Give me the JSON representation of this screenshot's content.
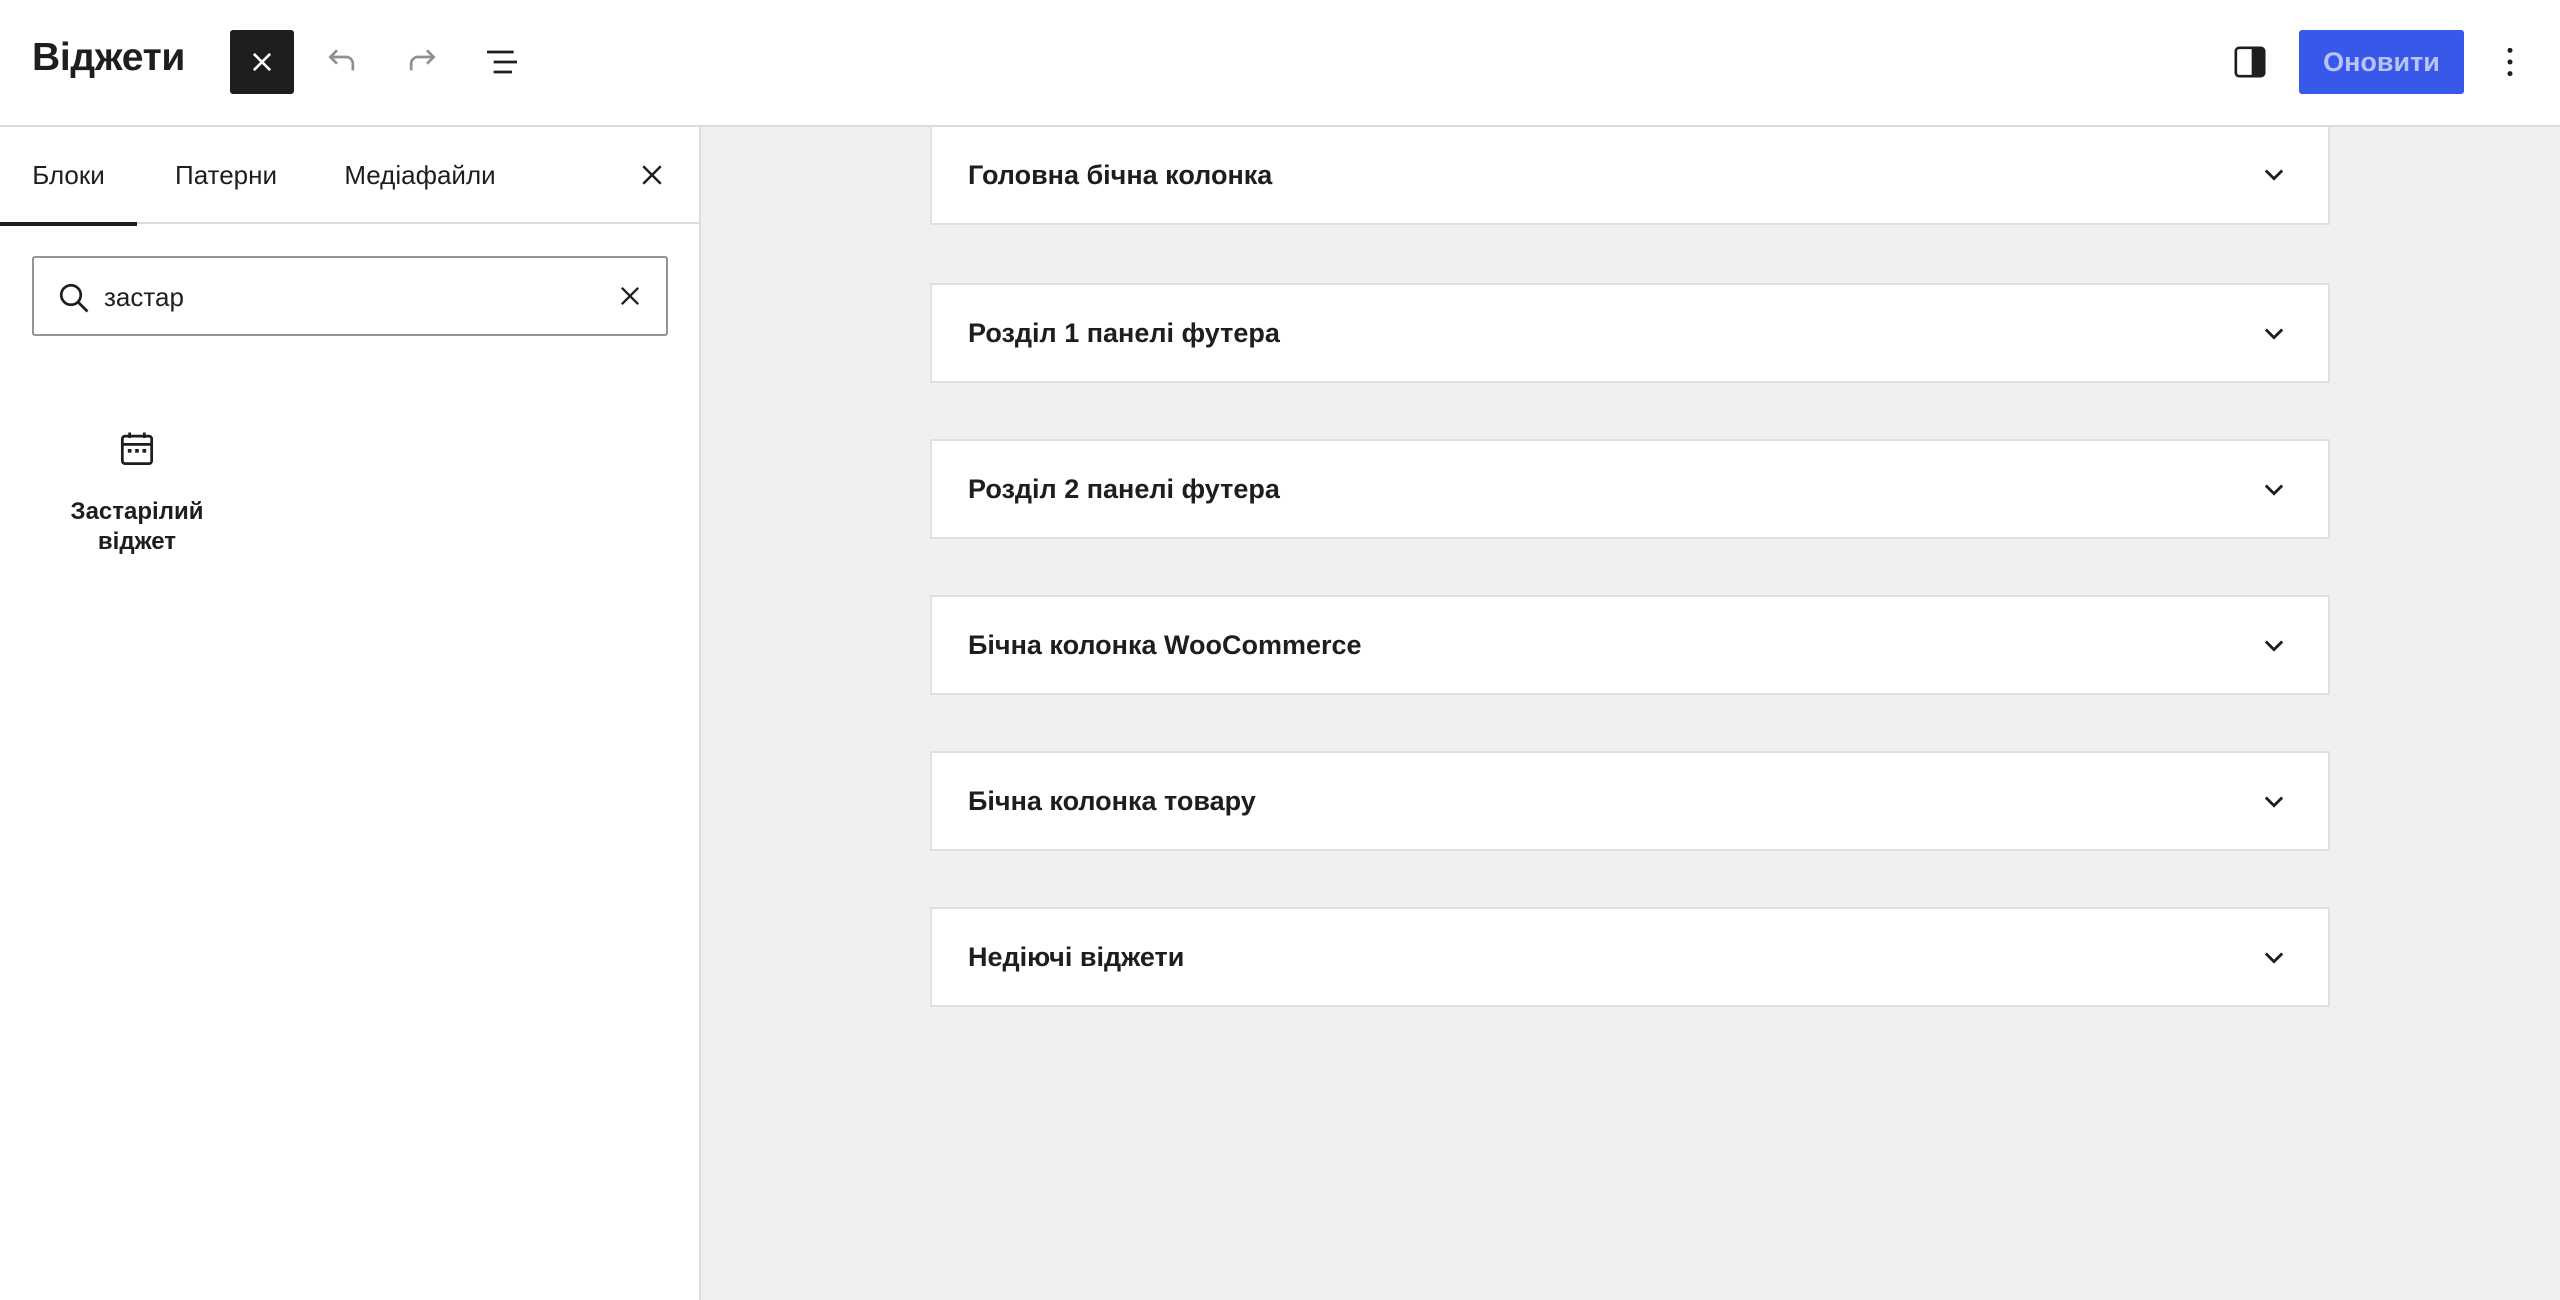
{
  "header": {
    "title": "Віджети",
    "update_label": "Оновити",
    "toggle_icon": "close-icon",
    "undo_icon": "undo-icon",
    "redo_icon": "redo-icon",
    "list_view_icon": "list-view-icon",
    "settings_icon": "sidebar-toggle-icon",
    "more_icon": "more-vertical-icon",
    "colors": {
      "primary": "#3858e9",
      "primary_text": "#b7c4f6",
      "dark": "#1e1e1e"
    }
  },
  "inserter": {
    "tabs": [
      {
        "label": "Блоки",
        "active": true
      },
      {
        "label": "Патерни",
        "active": false
      },
      {
        "label": "Медіафайли",
        "active": false
      }
    ],
    "search": {
      "value": "застар",
      "placeholder": "Пошук"
    },
    "results": [
      {
        "label": "Застарілий віджет",
        "icon": "calendar-widget-icon"
      }
    ]
  },
  "canvas": {
    "background": "#f0f0f0",
    "widget_areas": [
      {
        "title": "Головна бічна колонка"
      },
      {
        "title": "Розділ 1 панелі футера"
      },
      {
        "title": "Розділ 2 панелі футера"
      },
      {
        "title": "Бічна колонка WooCommerce"
      },
      {
        "title": "Бічна колонка товару"
      },
      {
        "title": "Недіючі віджети"
      }
    ]
  }
}
